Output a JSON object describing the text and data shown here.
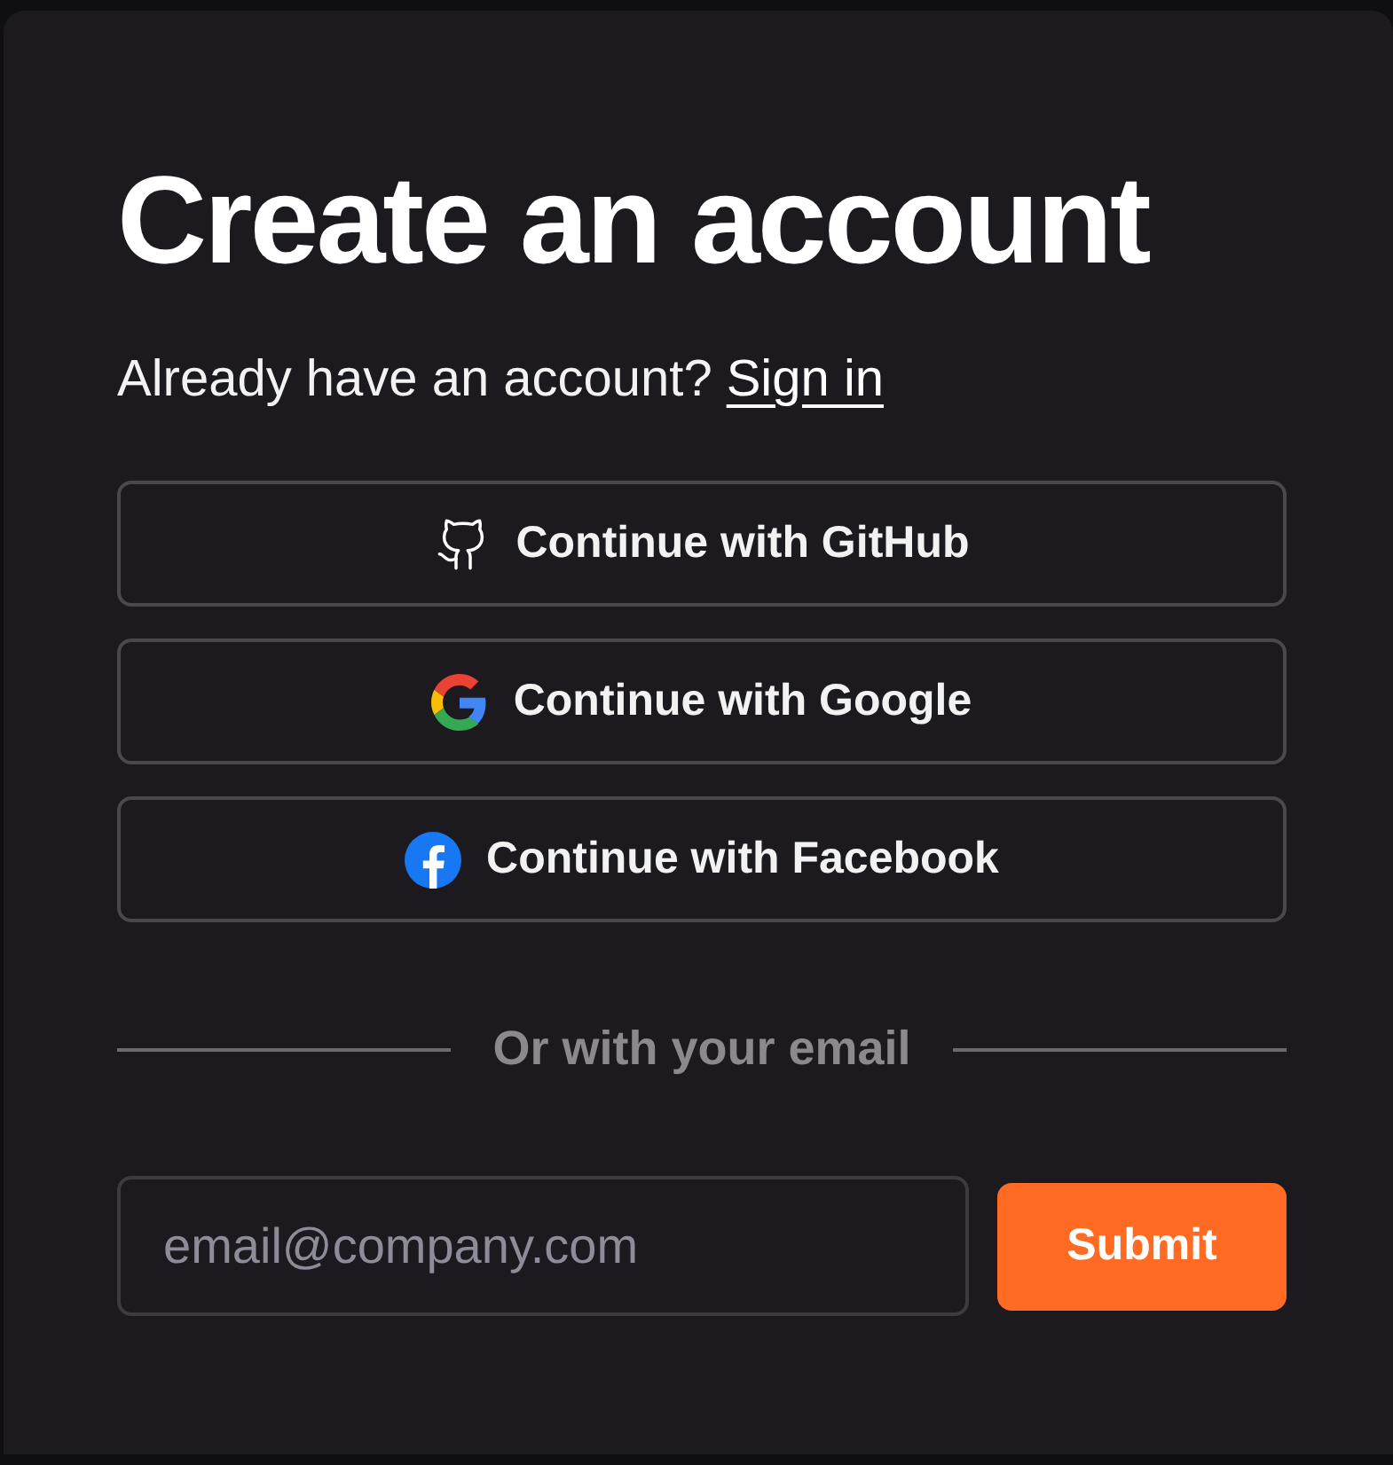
{
  "title": "Create an account",
  "signin_prompt": {
    "text": "Already have an account?",
    "link": "Sign in"
  },
  "providers": [
    {
      "kind": "github",
      "label": "Continue with GitHub"
    },
    {
      "kind": "google",
      "label": "Continue with Google"
    },
    {
      "kind": "facebook",
      "label": "Continue with Facebook"
    }
  ],
  "divider": "Or with your email",
  "email": {
    "placeholder": "email@company.com"
  },
  "submit": "Submit"
}
